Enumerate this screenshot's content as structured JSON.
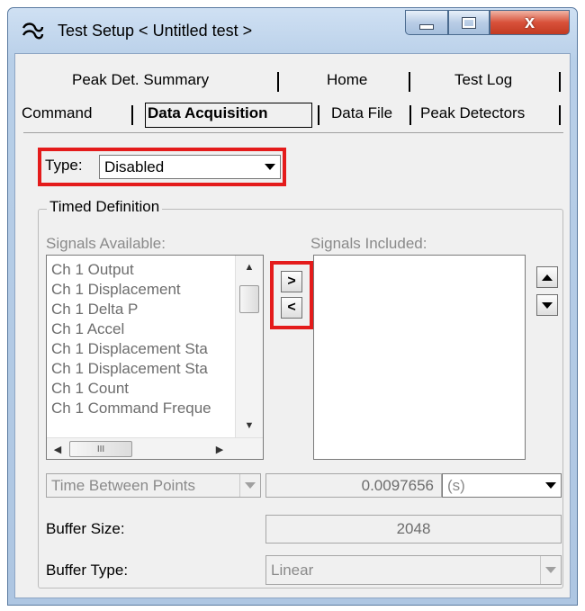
{
  "window": {
    "title": "Test Setup < Untitled test >",
    "close_glyph": "x",
    "icon": "settings-app-icon"
  },
  "tabs": {
    "row1": [
      "Peak Det. Summary",
      "Home",
      "Test Log"
    ],
    "row2": [
      "Command",
      "Data Acquisition",
      "Data File",
      "Peak Detectors"
    ],
    "active": "Data Acquisition"
  },
  "type": {
    "label": "Type:",
    "value": "Disabled"
  },
  "timed_definition": {
    "title": "Timed Definition",
    "signals_available_label": "Signals Available:",
    "signals_included_label": "Signals Included:",
    "signals_available": [
      "Ch 1 Output",
      "Ch 1 Displacement",
      "Ch 1 Delta P",
      "Ch 1 Accel",
      "Ch 1 Displacement Sta",
      "Ch 1 Displacement Sta",
      "Ch 1 Count",
      "Ch 1 Command Freque"
    ],
    "signals_included": [],
    "add_glyph": ">",
    "remove_glyph": "<",
    "hscroll_grip": "III"
  },
  "time_between": {
    "mode": "Time Between Points",
    "value": "0.0097656",
    "unit": "(s)"
  },
  "buffer_size": {
    "label": "Buffer Size:",
    "value": "2048"
  },
  "buffer_type": {
    "label": "Buffer Type:",
    "value": "Linear"
  },
  "colors": {
    "highlight": "#e41b1b",
    "window_frame": "#aec6e2",
    "close_button": "#c8432b"
  }
}
